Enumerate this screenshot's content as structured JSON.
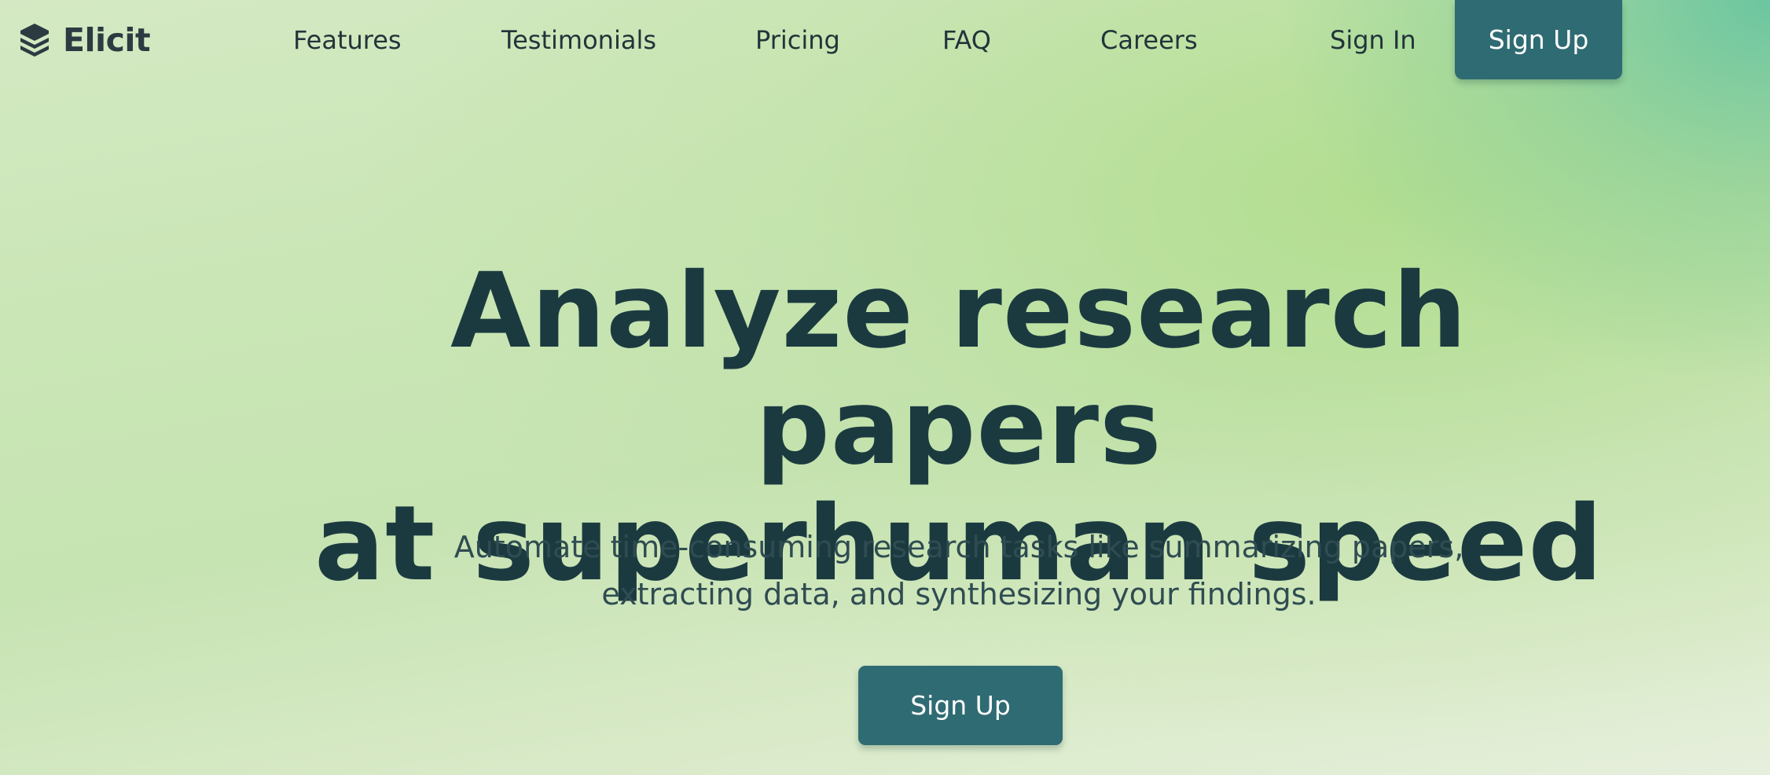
{
  "brand": {
    "name": "Elicit",
    "icon": "stacked-layers-logo-icon"
  },
  "nav": {
    "links": [
      {
        "label": "Features"
      },
      {
        "label": "Testimonials"
      },
      {
        "label": "Pricing"
      },
      {
        "label": "FAQ"
      },
      {
        "label": "Careers"
      }
    ],
    "sign_in": "Sign In",
    "sign_up": "Sign Up"
  },
  "hero": {
    "title_line1": "Analyze research papers",
    "title_line2": "at superhuman speed",
    "subtitle_line1": "Automate time-consuming research tasks like summarizing papers,",
    "subtitle_line2": "extracting data, and synthesizing your findings.",
    "cta": "Sign Up"
  },
  "colors": {
    "primary_button": "#2f6b72",
    "heading_text": "#1b3a40",
    "background_green": "#c6e3b2",
    "accent_teal": "#68c4a0"
  }
}
